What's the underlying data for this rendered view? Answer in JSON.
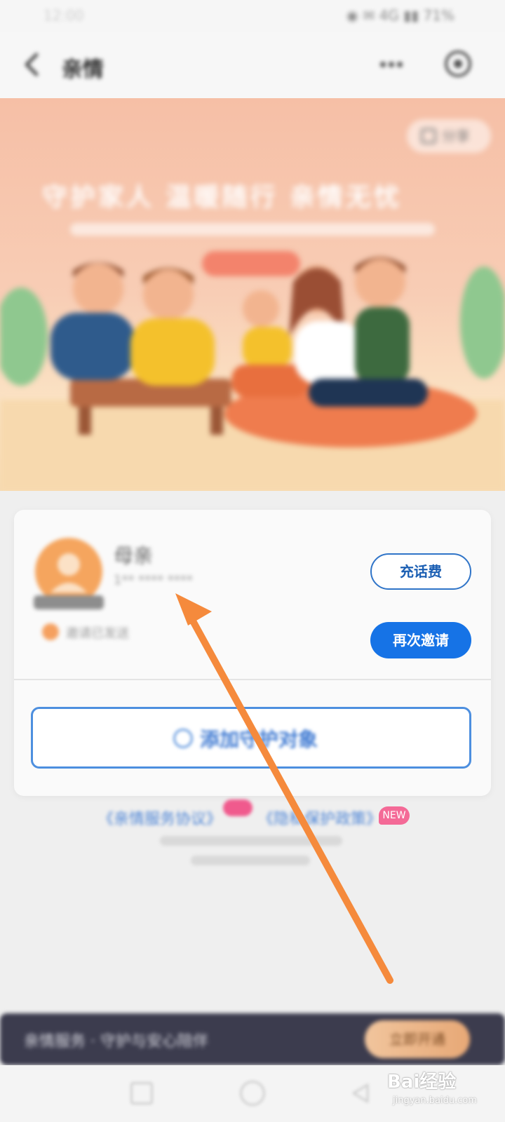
{
  "status_bar": {
    "time": "12:00",
    "indicators": "◉ ✉ 4G ▮▮ 71%"
  },
  "nav": {
    "title": "亲情",
    "back_icon": "chevron-left-icon",
    "more_icon": "more-dots-icon",
    "settings_icon": "settings-icon"
  },
  "banner": {
    "share_label": "分享",
    "slogan": "守护家人 温暖随行 亲情无忧"
  },
  "contact": {
    "name": "母亲",
    "phone": "1** **** ****",
    "status": "邀请已发送"
  },
  "buttons": {
    "topup": "充话费",
    "reinvite": "再次邀请"
  },
  "add_target": {
    "label": "添加守护对象"
  },
  "links": {
    "link_a": "《亲情服务协议》",
    "link_b": "《隐私保护政策》",
    "new_badge": "NEW"
  },
  "promo": {
    "text": "亲情服务 · 守护与安心陪伴",
    "button": "立即开通"
  },
  "watermark": {
    "logo": "Bai经验",
    "url": "jingyan.baidu.com"
  },
  "colors": {
    "primary": "#1673e6",
    "outline": "#2f74c8",
    "arrow": "#f58a3c",
    "banner": "#f6bfa6"
  }
}
